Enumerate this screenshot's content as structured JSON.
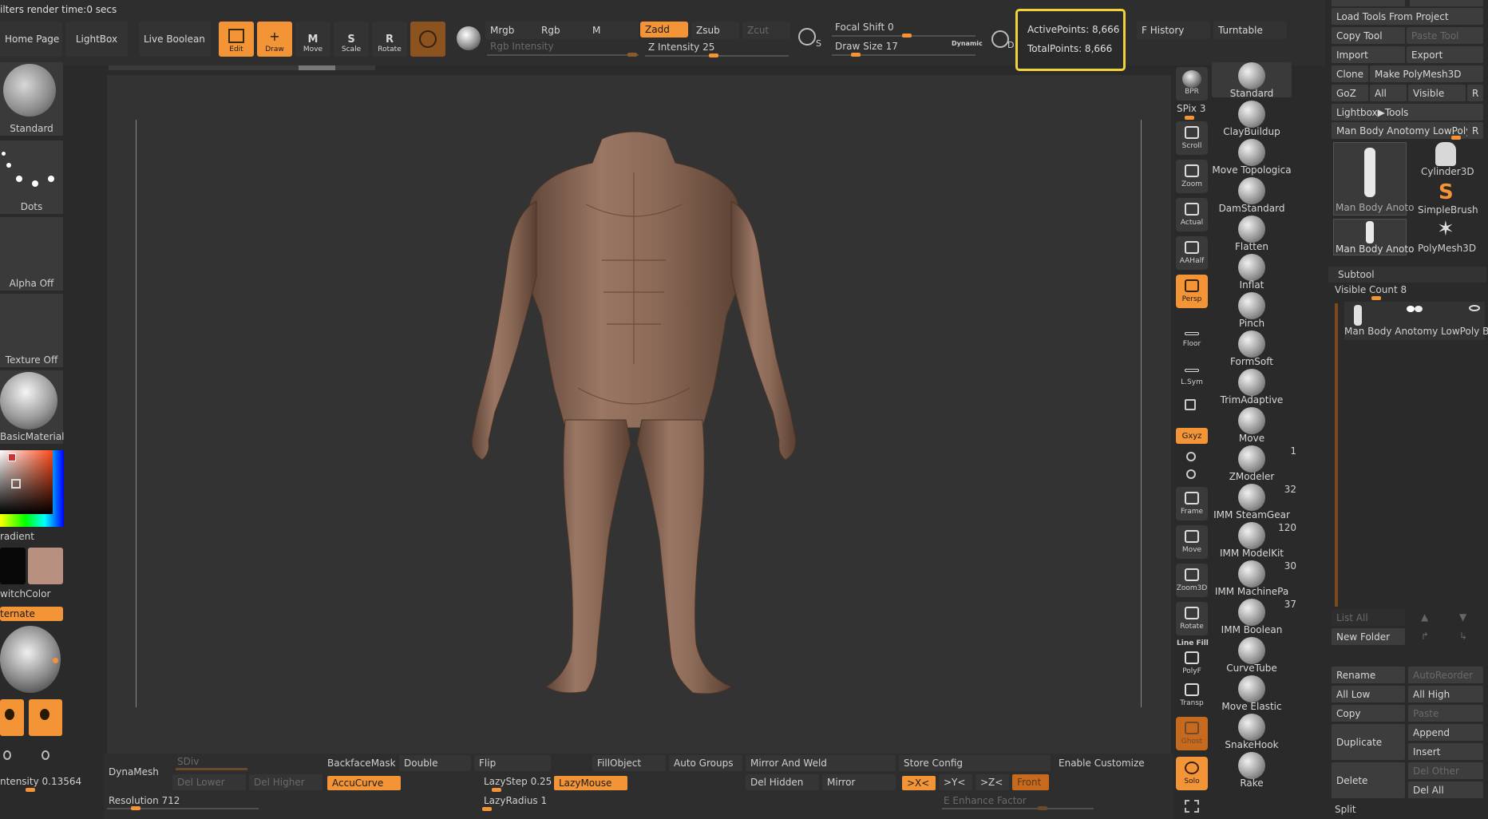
{
  "top": {
    "render_status": "ilters render time:0 secs",
    "home_page": "Home Page",
    "lightbox": "LightBox",
    "live_boolean": "Live Boolean",
    "edit": "Edit",
    "draw": "Draw",
    "move": "Move",
    "scale": "Scale",
    "rotate": "Rotate",
    "mrgb": "Mrgb",
    "rgb": "Rgb",
    "m": "M",
    "rgb_intensity": "Rgb Intensity",
    "zadd": "Zadd",
    "zsub": "Zsub",
    "zcut": "Zcut",
    "z_intensity": "Z Intensity 25",
    "focal_shift": "Focal Shift 0",
    "draw_size": "Draw Size 17",
    "dynamic": "Dynamic",
    "s_label": "S",
    "d_label": "D",
    "active_points": "ActivePoints: 8,666",
    "total_points": "TotalPoints: 8,666",
    "f_history": "F History",
    "turntable": "Turntable"
  },
  "left": {
    "brush_name": "Standard",
    "stroke_name": "Dots",
    "alpha": "Alpha Off",
    "texture": "Texture Off",
    "material": "BasicMaterial",
    "gradient": "radient",
    "switch_color": "witchColor",
    "alternate": "ternate",
    "intensity": "ntensity 0.13564"
  },
  "nav": {
    "bpr": "BPR",
    "spix": "SPix 3",
    "scroll": "Scroll",
    "zoom": "Zoom",
    "actual": "Actual",
    "aahalf": "AAHalf",
    "persp": "Persp",
    "floor": "Floor",
    "lsym": "L.Sym",
    "xyz": "Gxyz",
    "frame": "Frame",
    "move": "Move",
    "zoom3d": "Zoom3D",
    "rotate": "Rotate",
    "line_fill": "Line Fill",
    "polyf": "PolyF",
    "transp": "Transp",
    "ghost": "Ghost",
    "solo": "Solo"
  },
  "brushes": [
    {
      "name": "Standard",
      "count": ""
    },
    {
      "name": "ClayBuildup",
      "count": ""
    },
    {
      "name": "Move Topologica",
      "count": ""
    },
    {
      "name": "DamStandard",
      "count": ""
    },
    {
      "name": "Flatten",
      "count": ""
    },
    {
      "name": "Inflat",
      "count": ""
    },
    {
      "name": "Pinch",
      "count": ""
    },
    {
      "name": "FormSoft",
      "count": ""
    },
    {
      "name": "TrimAdaptive",
      "count": ""
    },
    {
      "name": "Move",
      "count": ""
    },
    {
      "name": "ZModeler",
      "count": "1"
    },
    {
      "name": "IMM SteamGear",
      "count": "32"
    },
    {
      "name": "IMM ModelKit",
      "count": "120"
    },
    {
      "name": "IMM MachinePa",
      "count": "30"
    },
    {
      "name": "IMM Boolean",
      "count": "37"
    },
    {
      "name": "CurveTube",
      "count": ""
    },
    {
      "name": "Move Elastic",
      "count": ""
    },
    {
      "name": "SnakeHook",
      "count": ""
    },
    {
      "name": "Rake",
      "count": ""
    }
  ],
  "tool": {
    "load_tools": "Load Tools From Project",
    "copy_tool": "Copy Tool",
    "paste_tool": "Paste Tool",
    "import": "Import",
    "export": "Export",
    "clone": "Clone",
    "make_polymesh": "Make PolyMesh3D",
    "goz": "GoZ",
    "all": "All",
    "visible": "Visible",
    "r": "R",
    "lightbox_tools": "Lightbox▶Tools",
    "current_tool": "Man Body Anotomy LowPoly I",
    "thumbs": [
      {
        "name": "Man Body Anoto"
      },
      {
        "name": "Cylinder3D"
      },
      {
        "name": "SimpleBrush"
      },
      {
        "name": "Man Body Anoto"
      },
      {
        "name": "PolyMesh3D"
      }
    ]
  },
  "subtool": {
    "title": "Subtool",
    "visible_count": "Visible Count 8",
    "item": "Man Body Anotomy LowPoly Bo",
    "list_all": "List All",
    "new_folder": "New Folder",
    "rename": "Rename",
    "auto_reorder": "AutoReorder",
    "all_low": "All Low",
    "all_high": "All High",
    "copy": "Copy",
    "paste": "Paste",
    "duplicate": "Duplicate",
    "append": "Append",
    "insert": "Insert",
    "delete": "Delete",
    "del_other": "Del Other",
    "del_all": "Del All",
    "split": "Split"
  },
  "bottom": {
    "dynamesh": "DynaMesh",
    "sdiv": "SDiv",
    "del_lower": "Del Lower",
    "del_higher": "Del Higher",
    "resolution": "Resolution 712",
    "backface_mask": "BackfaceMask",
    "double": "Double",
    "accucurve": "AccuCurve",
    "flip": "Flip",
    "lazystep": "LazyStep 0.25",
    "lazymouse": "LazyMouse",
    "lazyradius": "LazyRadius 1",
    "fillobject": "FillObject",
    "auto_groups": "Auto Groups",
    "mirror_and_weld": "Mirror And Weld",
    "del_hidden": "Del Hidden",
    "mirror": "Mirror",
    "store_config": "Store Config",
    "enable_customize": "Enable Customize",
    "x_sym": ">X<",
    "y_sym": ">Y<",
    "z_sym": ">Z<",
    "front": "Front",
    "enhance_factor": "E Enhance Factor"
  },
  "colors": {
    "accent": "#f39436",
    "highlight_box": "#f2d23a",
    "skin": "#8a6a58"
  }
}
